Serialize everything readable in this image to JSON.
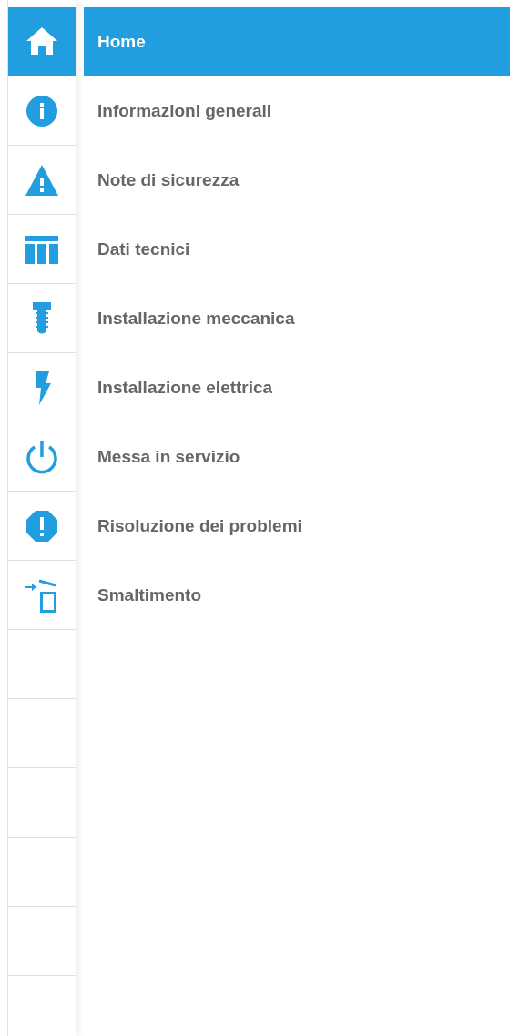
{
  "menu": {
    "items": [
      {
        "label": "Home",
        "selected": true
      },
      {
        "label": "Informazioni generali",
        "selected": false
      },
      {
        "label": "Note di sicurezza",
        "selected": false
      },
      {
        "label": "Dati tecnici",
        "selected": false
      },
      {
        "label": "Installazione meccanica",
        "selected": false
      },
      {
        "label": "Installazione elettrica",
        "selected": false
      },
      {
        "label": "Messa in servizio",
        "selected": false
      },
      {
        "label": "Risoluzione dei problemi",
        "selected": false
      },
      {
        "label": "Smaltimento",
        "selected": false
      }
    ]
  }
}
